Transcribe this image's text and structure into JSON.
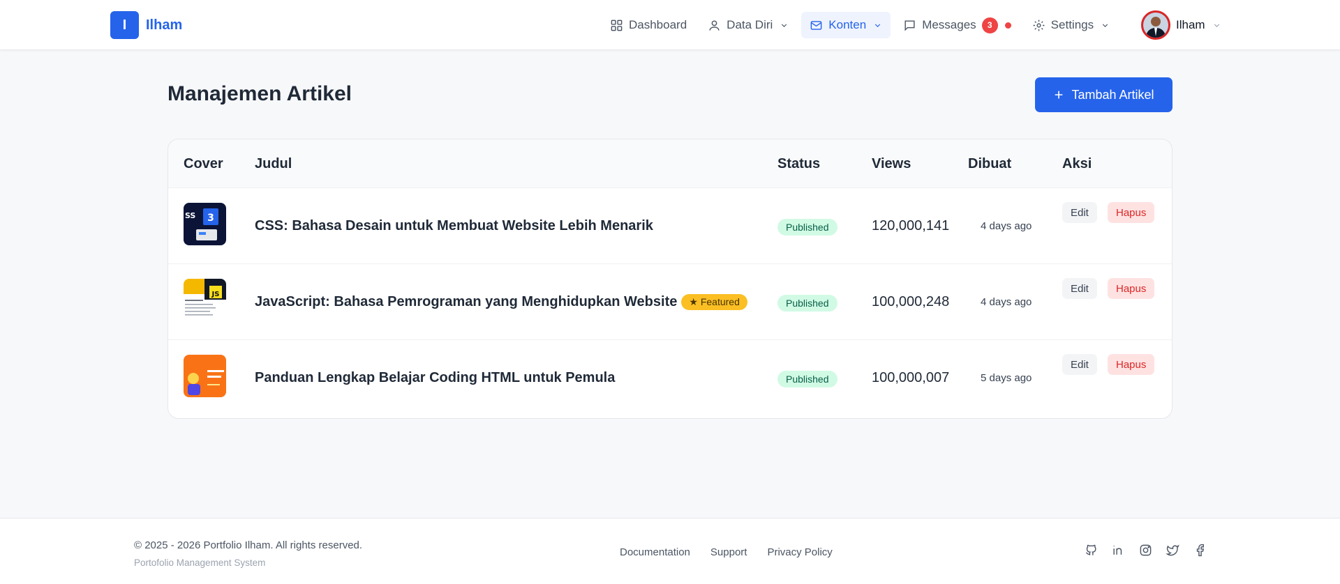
{
  "brand": {
    "initial": "I",
    "name": "Ilham"
  },
  "nav": {
    "dashboard": "Dashboard",
    "data_diri": "Data Diri",
    "konten": "Konten",
    "messages": "Messages",
    "messages_count": "3",
    "settings": "Settings"
  },
  "user": {
    "name": "Ilham"
  },
  "page": {
    "title": "Manajemen Artikel",
    "add_button": "Tambah Artikel"
  },
  "table": {
    "headers": {
      "cover": "Cover",
      "title": "Judul",
      "status": "Status",
      "views": "Views",
      "created": "Dibuat",
      "actions": "Aksi"
    },
    "rows": [
      {
        "title": "CSS: Bahasa Desain untuk Membuat Website Lebih Menarik",
        "featured": "",
        "status": "Published",
        "views": "120,000,141",
        "created": "4 days ago",
        "edit": "Edit",
        "delete": "Hapus"
      },
      {
        "title": "JavaScript: Bahasa Pemrograman yang Menghidupkan Website",
        "featured": "★ Featured",
        "status": "Published",
        "views": "100,000,248",
        "created": "4 days ago",
        "edit": "Edit",
        "delete": "Hapus"
      },
      {
        "title": "Panduan Lengkap Belajar Coding HTML untuk Pemula",
        "featured": "",
        "status": "Published",
        "views": "100,000,007",
        "created": "5 days ago",
        "edit": "Edit",
        "delete": "Hapus"
      }
    ]
  },
  "footer": {
    "copyright": "© 2025 - 2026 Portfolio Ilham. All rights reserved.",
    "subtitle": "Portofolio Management System",
    "links": {
      "documentation": "Documentation",
      "support": "Support",
      "privacy": "Privacy Policy"
    }
  },
  "colors": {
    "primary": "#2563eb",
    "danger": "#ef4444",
    "success_bg": "#d1fae5",
    "featured": "#fbbf24"
  },
  "icons": [
    "dashboard-icon",
    "user-icon",
    "mail-icon",
    "message-icon",
    "settings-icon",
    "chevron-down-icon",
    "plus-icon",
    "github-icon",
    "linkedin-icon",
    "instagram-icon",
    "twitter-icon",
    "facebook-icon"
  ]
}
